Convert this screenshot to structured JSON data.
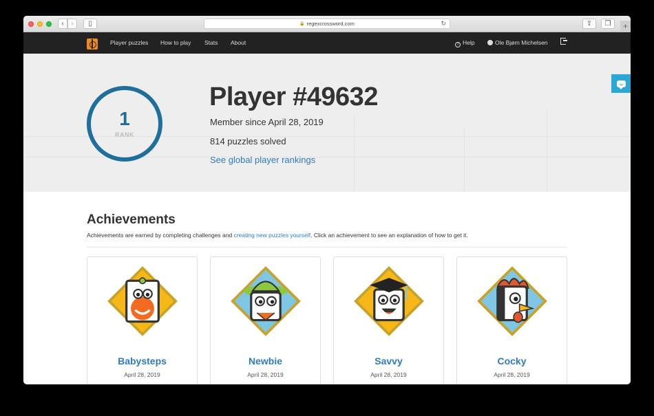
{
  "browser": {
    "url": "regexcrossword.com"
  },
  "nav": {
    "links": [
      "Player puzzles",
      "How to play",
      "Stats",
      "About"
    ],
    "help": "Help",
    "user": "Ole Bjørn Michelsen"
  },
  "profile": {
    "rank": "1",
    "rank_label": "RANK",
    "title": "Player #49632",
    "member_since": "Member since April 28, 2019",
    "solved": "814 puzzles solved",
    "rankings_link": "See global player rankings"
  },
  "achievements": {
    "heading": "Achievements",
    "desc_before": "Achievements are earned by completing challenges and ",
    "desc_link": "creating new puzzles yourself",
    "desc_after": ". Click an achievement to see an explanation of how to get it.",
    "items": [
      {
        "name": "Babysteps",
        "date": "April 28, 2019",
        "bg": "#f5b818",
        "char": "#f26b21"
      },
      {
        "name": "Newbie",
        "date": "April 28, 2019",
        "bg": "#7fc6e4",
        "char": "#8dc63f"
      },
      {
        "name": "Savvy",
        "date": "April 28, 2019",
        "bg": "#f5b818",
        "char": "#222222"
      },
      {
        "name": "Cocky",
        "date": "April 28, 2019",
        "bg": "#7fc6e4",
        "char": "#e2572b"
      }
    ]
  },
  "colors": {
    "accent": "#1f6f9c",
    "link": "#2d7bbf",
    "nav_bg": "#222222",
    "chat": "#2aa7d5"
  }
}
